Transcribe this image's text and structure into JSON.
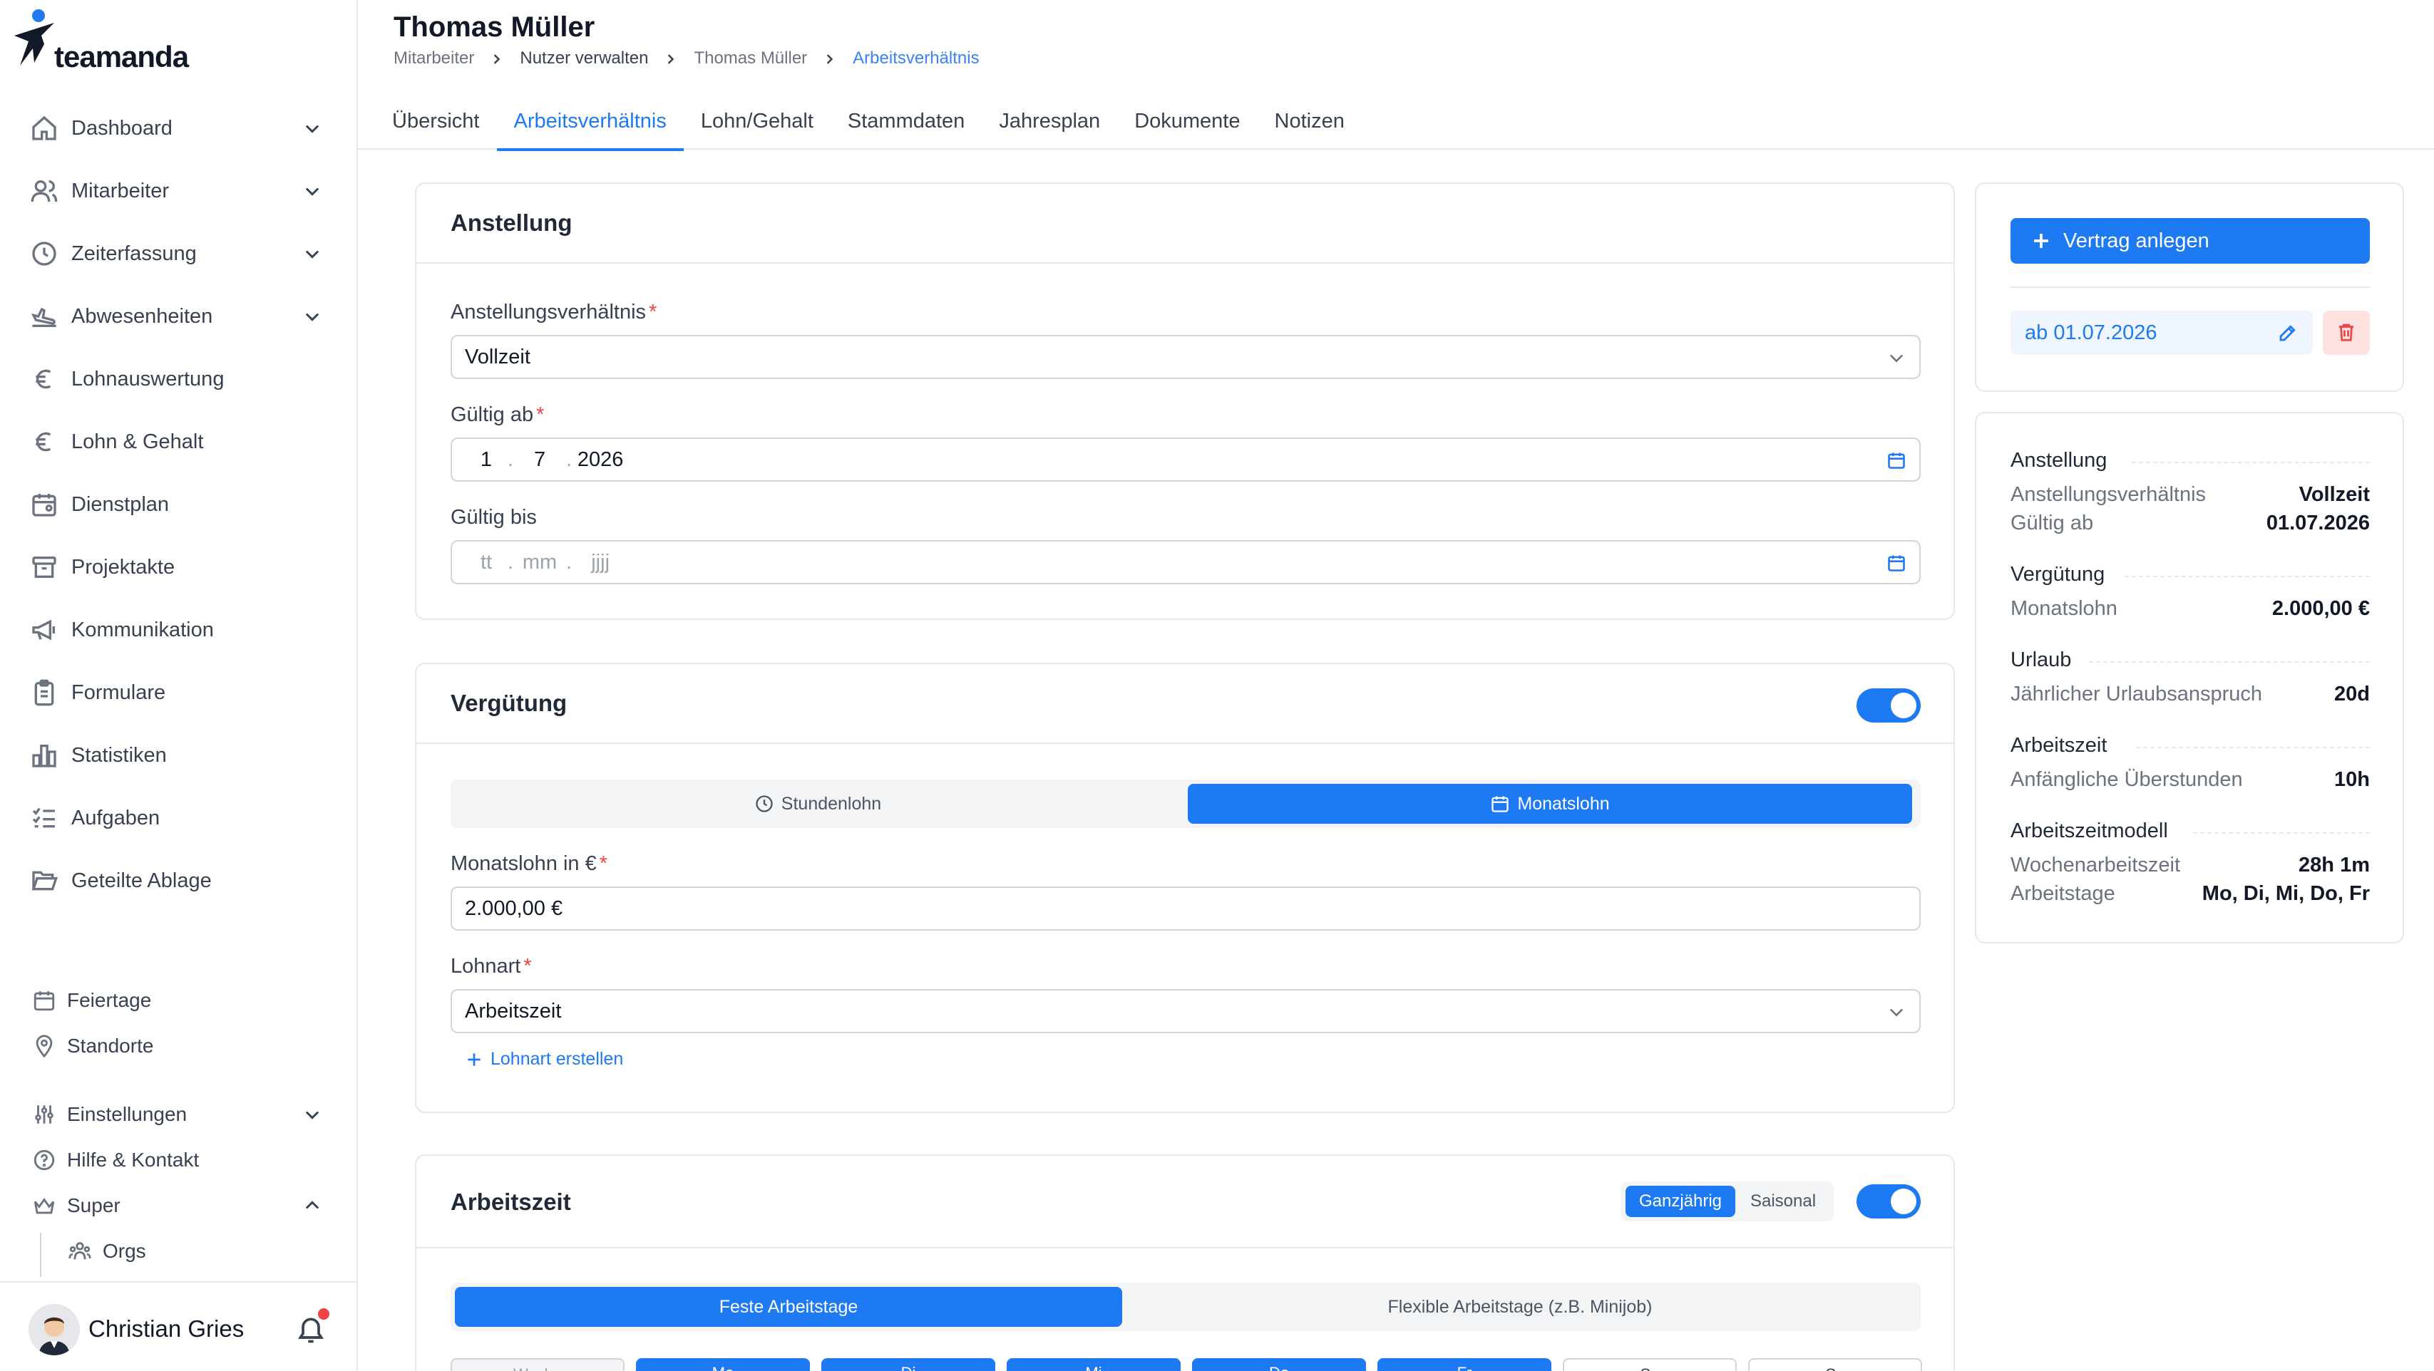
{
  "app": {
    "brand": "teamanda"
  },
  "sidebar": {
    "items": [
      {
        "label": "Dashboard",
        "icon": "home-icon",
        "expandable": true
      },
      {
        "label": "Mitarbeiter",
        "icon": "users-icon",
        "expandable": true
      },
      {
        "label": "Zeiterfassung",
        "icon": "clock-icon",
        "expandable": true
      },
      {
        "label": "Abwesenheiten",
        "icon": "plane-icon",
        "expandable": true
      },
      {
        "label": "Lohnauswertung",
        "icon": "euro-icon",
        "expandable": false
      },
      {
        "label": "Lohn & Gehalt",
        "icon": "euro-icon",
        "expandable": false
      },
      {
        "label": "Dienstplan",
        "icon": "calendar-user-icon",
        "expandable": false
      },
      {
        "label": "Projektakte",
        "icon": "archive-icon",
        "expandable": false
      },
      {
        "label": "Kommunikation",
        "icon": "megaphone-icon",
        "expandable": false
      },
      {
        "label": "Formulare",
        "icon": "clipboard-icon",
        "expandable": false
      },
      {
        "label": "Statistiken",
        "icon": "bar-chart-icon",
        "expandable": false
      },
      {
        "label": "Aufgaben",
        "icon": "list-check-icon",
        "expandable": false
      },
      {
        "label": "Geteilte Ablage",
        "icon": "folder-open-icon",
        "expandable": false
      }
    ],
    "secondary": [
      {
        "label": "Feiertage",
        "icon": "calendar-icon"
      },
      {
        "label": "Standorte",
        "icon": "map-pin-icon"
      },
      {
        "label": "Einstellungen",
        "icon": "sliders-icon"
      },
      {
        "label": "Hilfe & Kontakt",
        "icon": "help-circle-icon"
      },
      {
        "label": "Super",
        "icon": "crown-icon"
      },
      {
        "label": "Orgs",
        "icon": "users-group-icon"
      }
    ],
    "user": {
      "name": "Christian Gries",
      "has_notification": true
    }
  },
  "header": {
    "title": "Thomas Müller",
    "breadcrumb": [
      "Mitarbeiter",
      "Nutzer verwalten",
      "Thomas Müller",
      "Arbeitsverhältnis"
    ],
    "tabs": [
      "Übersicht",
      "Arbeitsverhältnis",
      "Lohn/Gehalt",
      "Stammdaten",
      "Jahresplan",
      "Dokumente",
      "Notizen"
    ],
    "active_tab": "Arbeitsverhältnis"
  },
  "anstellung": {
    "title": "Anstellung",
    "verhaeltnis_label": "Anstellungsverhältnis",
    "verhaeltnis_value": "Vollzeit",
    "gueltig_ab_label": "Gültig ab",
    "gueltig_ab": {
      "day": "1",
      "month": "7",
      "year": "2026"
    },
    "gueltig_bis_label": "Gültig bis",
    "gueltig_bis_placeholder": {
      "day": "tt",
      "month": "mm",
      "year": "jjjj"
    },
    "date_sep": "."
  },
  "verguetung": {
    "title": "Vergütung",
    "enabled": true,
    "mode_options": [
      "Stundenlohn",
      "Monatslohn"
    ],
    "mode_selected": "Monatslohn",
    "monatslohn_label": "Monatslohn in €",
    "monatslohn_value": "2.000,00 €",
    "lohnart_label": "Lohnart",
    "lohnart_value": "Arbeitszeit",
    "lohnart_create": "Lohnart erstellen"
  },
  "arbeitszeit": {
    "title": "Arbeitszeit",
    "period_options": [
      "Ganzjährig",
      "Saisonal"
    ],
    "period_selected": "Ganzjährig",
    "enabled": true,
    "type_options": [
      "Feste Arbeitstage",
      "Flexible Arbeitstage (z.B. Minijob)"
    ],
    "type_selected": "Feste Arbeitstage",
    "day_buttons": [
      {
        "label": "Woche",
        "active": false
      },
      {
        "label": "Mo",
        "active": true
      },
      {
        "label": "Di",
        "active": true
      },
      {
        "label": "Mi",
        "active": true
      },
      {
        "label": "Do",
        "active": true
      },
      {
        "label": "Fr",
        "active": true
      },
      {
        "label": "Sa",
        "active": false
      },
      {
        "label": "So",
        "active": false
      }
    ]
  },
  "vertrag": {
    "create_label": "Vertrag anlegen",
    "contract_label": "ab 01.07.2026"
  },
  "summary": {
    "sections": [
      {
        "title": "Anstellung",
        "rows": [
          {
            "key": "Anstellungsverhältnis",
            "value": "Vollzeit"
          },
          {
            "key": "Gültig ab",
            "value": "01.07.2026"
          }
        ]
      },
      {
        "title": "Vergütung",
        "rows": [
          {
            "key": "Monatslohn",
            "value": "2.000,00 €"
          }
        ]
      },
      {
        "title": "Urlaub",
        "rows": [
          {
            "key": "Jährlicher Urlaubsanspruch",
            "value": "20d"
          }
        ]
      },
      {
        "title": "Arbeitszeit",
        "rows": [
          {
            "key": "Anfängliche Überstunden",
            "value": "10h"
          }
        ]
      },
      {
        "title": "Arbeitszeitmodell",
        "rows": [
          {
            "key": "Wochenarbeitszeit",
            "value": "28h 1m"
          },
          {
            "key": "Arbeitstage",
            "value": "Mo, Di, Mi, Do, Fr"
          }
        ]
      }
    ]
  },
  "colors": {
    "accent": "#1d7af3",
    "required": "#ef4444",
    "danger_bg": "#fee2e2",
    "chip_bg": "#eff6ff"
  }
}
